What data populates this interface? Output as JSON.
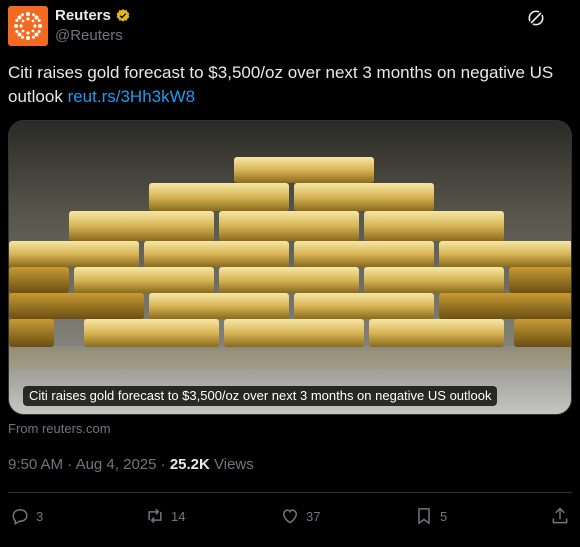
{
  "author": {
    "display_name": "Reuters",
    "handle": "@Reuters",
    "verified_badge_icon": "gold-verified-badge-icon",
    "avatar_icon": "reuters-logo-icon",
    "brand_color": "#f26a21"
  },
  "tweet": {
    "text": "Citi raises gold forecast to $3,500/oz over next 3 months on negative US outlook",
    "link_text": "reut.rs/3Hh3kW8",
    "link_color": "#1d9bf0"
  },
  "media": {
    "alt_subject": "gold-bars-stack",
    "caption": "Citi raises gold forecast to $3,500/oz over next 3 months on negative US outlook"
  },
  "source": "From reuters.com",
  "meta": {
    "time": "9:50 AM",
    "separator": "·",
    "date": "Aug 4, 2025",
    "views_count": "25.2K",
    "views_label": "Views"
  },
  "actions": {
    "replies": "3",
    "reposts": "14",
    "likes": "37",
    "bookmarks": "5"
  }
}
